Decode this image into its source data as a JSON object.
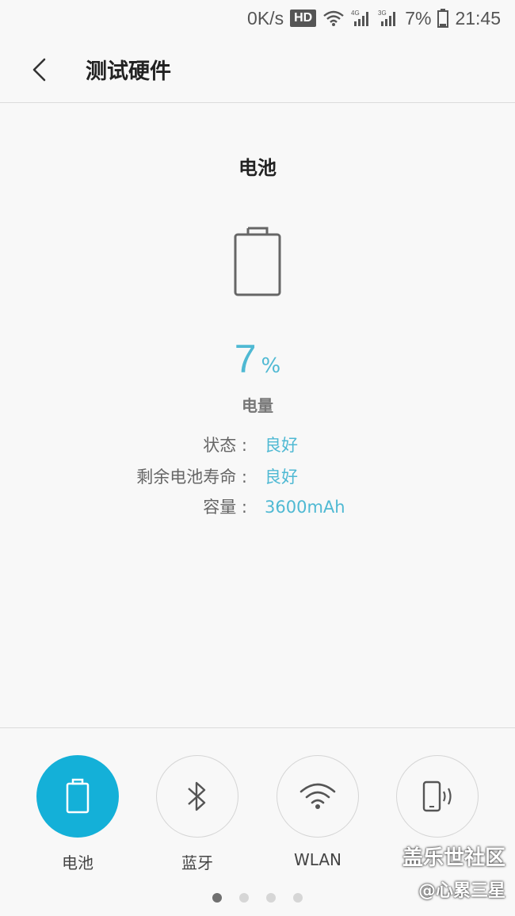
{
  "status_bar": {
    "speed": "0K/s",
    "hd": "HD",
    "net1": "4G",
    "net2": "3G",
    "battery": "7%",
    "time": "21:45"
  },
  "header": {
    "title": "测试硬件"
  },
  "battery": {
    "section_title": "电池",
    "percent": "7",
    "percent_unit": "%",
    "percent_label": "电量",
    "rows": [
      {
        "key": "状态 : ",
        "value": "良好"
      },
      {
        "key": "剩余电池寿命 : ",
        "value": "良好"
      },
      {
        "key": "容量 : ",
        "value": "3600mAh"
      }
    ]
  },
  "nav": {
    "items": [
      {
        "label": "电池",
        "icon": "battery-icon",
        "active": true
      },
      {
        "label": "蓝牙",
        "icon": "bluetooth-icon",
        "active": false
      },
      {
        "label": "WLAN",
        "icon": "wifi-icon",
        "active": false
      },
      {
        "label": "",
        "icon": "vibration-icon",
        "active": false
      }
    ],
    "page_count": 4,
    "current_page": 1
  },
  "watermark": {
    "line1": "盖乐世社区",
    "line2": "@心累三星"
  },
  "colors": {
    "accent": "#4fb9d3",
    "active_nav": "#14b0d8"
  }
}
